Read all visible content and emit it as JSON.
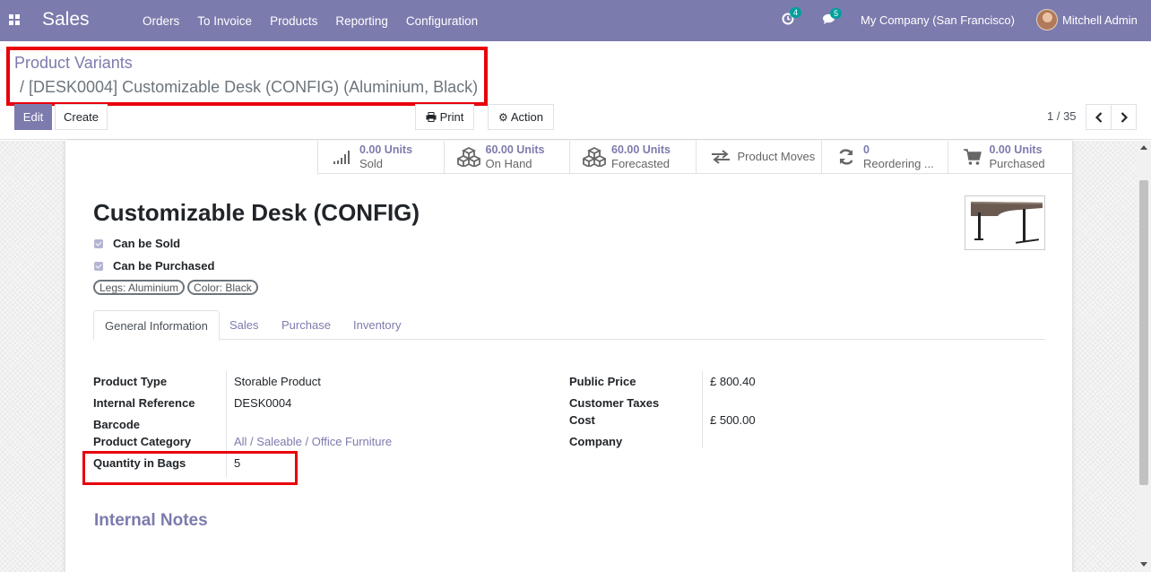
{
  "navbar": {
    "app_name": "Sales",
    "menu": [
      "Orders",
      "To Invoice",
      "Products",
      "Reporting",
      "Configuration"
    ],
    "activity_count": "4",
    "messages_count": "5",
    "company": "My Company (San Francisco)",
    "user": "Mitchell Admin"
  },
  "breadcrumb": {
    "root": "Product Variants",
    "current": "/ [DESK0004] Customizable Desk (CONFIG) (Aluminium, Black)"
  },
  "toolbar": {
    "edit": "Edit",
    "create": "Create",
    "print": "Print",
    "action": "Action",
    "pager": "1 / 35"
  },
  "smart_buttons": [
    {
      "value": "0.00 Units",
      "label": "Sold",
      "icon": "bar-chart-icon"
    },
    {
      "value": "60.00 Units",
      "label": "On Hand",
      "icon": "cubes-icon"
    },
    {
      "value": "60.00 Units",
      "label": "Forecasted",
      "icon": "cubes-icon"
    },
    {
      "value": "",
      "label": "Product Moves",
      "icon": "exchange-icon"
    },
    {
      "value": "0",
      "label": "Reordering ...",
      "icon": "refresh-icon"
    },
    {
      "value": "0.00 Units",
      "label": "Purchased",
      "icon": "shopping-cart-icon"
    }
  ],
  "product": {
    "name": "Customizable Desk (CONFIG)",
    "can_be_sold": "Can be Sold",
    "can_be_purchased": "Can be Purchased",
    "tags": [
      "Legs: Aluminium",
      "Color: Black"
    ]
  },
  "tabs": [
    "General Information",
    "Sales",
    "Purchase",
    "Inventory"
  ],
  "general": {
    "left": [
      {
        "label": "Product Type",
        "value": "Storable Product"
      },
      {
        "label": "Internal Reference",
        "value": "DESK0004"
      },
      {
        "label": "Barcode",
        "value": ""
      },
      {
        "label": "Product Category",
        "value": "All / Saleable / Office Furniture"
      },
      {
        "label": "Quantity in Bags",
        "value": "5"
      }
    ],
    "right": [
      {
        "label": "Public Price",
        "value": "£ 800.40"
      },
      {
        "label": "Customer Taxes",
        "value": ""
      },
      {
        "label": "Cost",
        "value": "£ 500.00"
      },
      {
        "label": "Company",
        "value": ""
      }
    ]
  },
  "notes_title": "Internal Notes",
  "colors": {
    "brand": "#7c7bad",
    "highlight": "#e8000b",
    "badge": "#00a09d"
  }
}
